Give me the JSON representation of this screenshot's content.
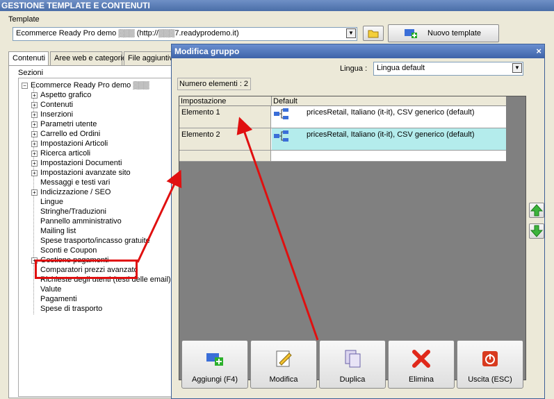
{
  "window": {
    "title": "GESTIONE TEMPLATE E CONTENUTI"
  },
  "template": {
    "label": "Template",
    "selected": "Ecommerce Ready Pro demo ▒▒▒ (http://▒▒▒7.readyprodemo.it)",
    "new_button": "Nuovo template"
  },
  "tabs": [
    "Contenuti",
    "Aree web e categorie",
    "File aggiuntivi"
  ],
  "sections": {
    "label": "Sezioni",
    "root": "Ecommerce Ready Pro demo ▒▒▒",
    "items": [
      {
        "label": "Aspetto grafico",
        "expandable": true
      },
      {
        "label": "Contenuti",
        "expandable": true
      },
      {
        "label": "Inserzioni",
        "expandable": true
      },
      {
        "label": "Parametri utente",
        "expandable": true
      },
      {
        "label": "Carrello ed Ordini",
        "expandable": true
      },
      {
        "label": "Impostazioni Articoli",
        "expandable": true
      },
      {
        "label": "Ricerca articoli",
        "expandable": true
      },
      {
        "label": "Impostazioni Documenti",
        "expandable": true
      },
      {
        "label": "Impostazioni avanzate sito",
        "expandable": true
      },
      {
        "label": "Messaggi e testi vari",
        "expandable": false
      },
      {
        "label": "Indicizzazione / SEO",
        "expandable": true
      },
      {
        "label": "Lingue",
        "expandable": false
      },
      {
        "label": "Stringhe/Traduzioni",
        "expandable": false
      },
      {
        "label": "Pannello amministrativo",
        "expandable": false
      },
      {
        "label": "Mailing list",
        "expandable": false
      },
      {
        "label": "Spese trasporto/incasso gratuite",
        "expandable": false
      },
      {
        "label": "Sconti e Coupon",
        "expandable": false
      },
      {
        "label": "Gestione pagamenti",
        "expandable": true
      },
      {
        "label": "Comparatori prezzi avanzato",
        "expandable": false
      },
      {
        "label": "Richieste degli utenti (testi delle email)",
        "expandable": false
      },
      {
        "label": "Valute",
        "expandable": false
      },
      {
        "label": "Pagamenti",
        "expandable": false
      },
      {
        "label": "Spese di trasporto",
        "expandable": false
      }
    ]
  },
  "dialog": {
    "title": "Modifica gruppo",
    "close": "×",
    "language_label": "Lingua :",
    "language_value": "Lingua default",
    "count": "Numero elementi : 2",
    "grid": {
      "headers": [
        "Impostazione",
        "Default"
      ],
      "rows": [
        {
          "name": "Elemento 1",
          "value": "pricesRetail, Italiano (it-it), CSV generico (default)"
        },
        {
          "name": "Elemento 2",
          "value": "pricesRetail, Italiano (it-it), CSV generico (default)"
        }
      ]
    },
    "buttons": [
      "Aggiungi (F4)",
      "Modifica",
      "Duplica",
      "Elimina",
      "Uscita (ESC)"
    ]
  },
  "colors": {
    "annotation": "#e01010",
    "selected_row": "#b4ecec",
    "title_bar": "#4a6ea8"
  }
}
